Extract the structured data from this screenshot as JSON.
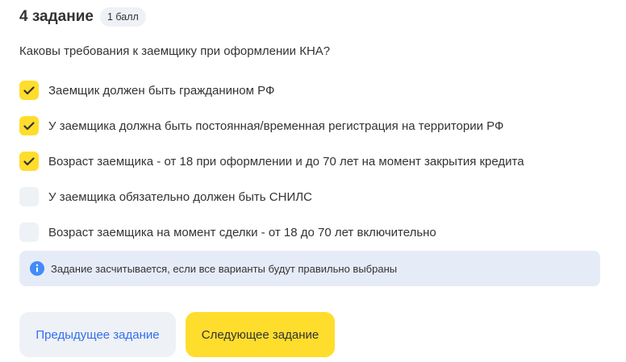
{
  "task": {
    "title": "4 задание",
    "points_badge": "1 балл"
  },
  "question": "Каковы требования к заемщику при оформлении КНА?",
  "options": [
    {
      "label": "Заемщик должен быть гражданином РФ",
      "checked": true
    },
    {
      "label": "У заемщика должна быть постоянная/временная регистрация на территории РФ",
      "checked": true
    },
    {
      "label": "Возраст заемщика - от 18 при оформлении и до 70 лет на момент закрытия кредита",
      "checked": true
    },
    {
      "label": "У заемщика обязательно должен быть СНИЛС",
      "checked": false
    },
    {
      "label": "Возраст заемщика на момент сделки - от 18 до 70 лет включительно",
      "checked": false
    }
  ],
  "info": {
    "icon": "info-icon",
    "text": "Задание засчитывается, если все варианты будут правильно выбраны"
  },
  "buttons": {
    "prev_label": "Предыдущее задание",
    "next_label": "Следующее задание"
  },
  "colors": {
    "accent_yellow": "#ffdd2d",
    "neutral_bg": "#eef1f6",
    "info_bg": "#e6ecf7",
    "info_icon": "#428bf9",
    "link_blue": "#336fee",
    "text": "#333333"
  }
}
